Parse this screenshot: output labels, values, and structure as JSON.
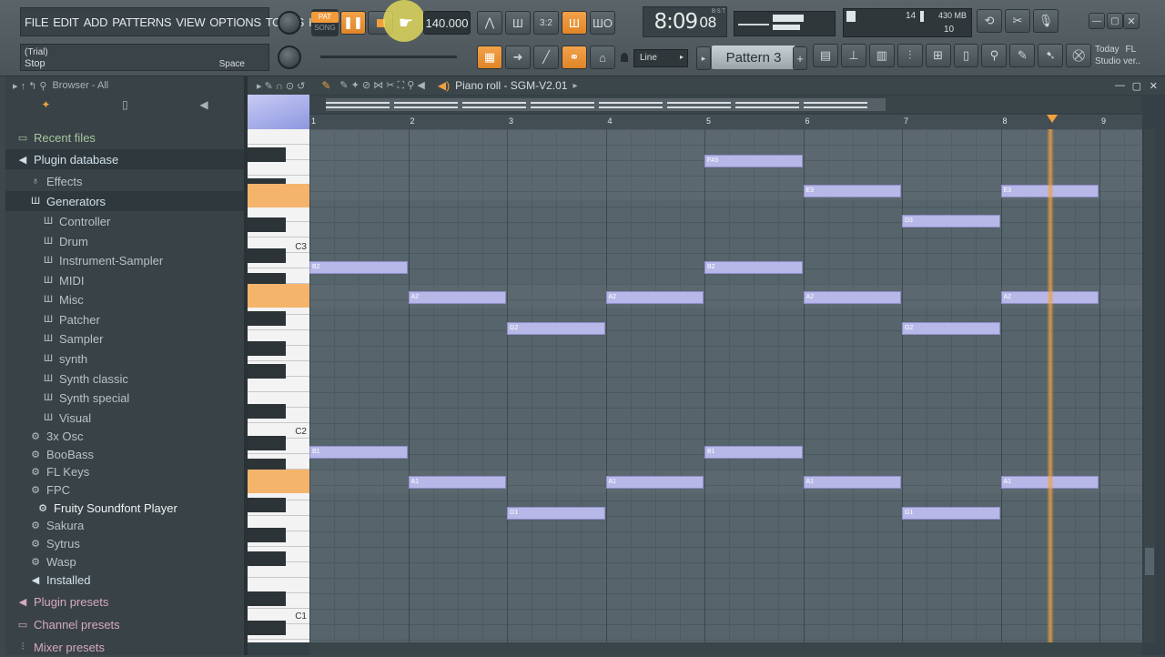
{
  "menu": [
    "FILE",
    "EDIT",
    "ADD",
    "PATTERNS",
    "VIEW",
    "OPTIONS",
    "TOOLS",
    "HELP"
  ],
  "hint": {
    "line1": "(Trial)",
    "line2": "Stop",
    "shortcut": "Space"
  },
  "transport": {
    "pat": "PAT",
    "song": "SONG",
    "tempo": "140.000",
    "time": "8:09",
    "time_small": "08",
    "bst": "B:S:T"
  },
  "cpu": {
    "mem": "430 MB",
    "val1": "14",
    "val2": "10"
  },
  "snap": "Line",
  "pattern": "Pattern 3",
  "news": {
    "l1": "Today",
    "l2": "FL",
    "l3": "Studio ver.."
  },
  "browser": {
    "title": "Browser - All",
    "items": [
      {
        "label": "Recent files",
        "icon": "folder-icon",
        "color": "#a6c5a0"
      },
      {
        "label": "Plugin database",
        "icon": "speaker-icon",
        "color": "#cfe0ea"
      },
      {
        "label": "Effects",
        "icon": "mic-icon",
        "color": "#b7c2c7"
      },
      {
        "label": "Generators",
        "icon": "piano-icon",
        "color": "#cfe0ea"
      },
      {
        "label": "Controller",
        "icon": "piano-icon",
        "color": "#b7c2c7"
      },
      {
        "label": "Drum",
        "icon": "piano-icon",
        "color": "#b7c2c7"
      },
      {
        "label": "Instrument-Sampler",
        "icon": "piano-icon",
        "color": "#b7c2c7"
      },
      {
        "label": "MIDI",
        "icon": "piano-icon",
        "color": "#b7c2c7"
      },
      {
        "label": "Misc",
        "icon": "piano-icon",
        "color": "#b7c2c7"
      },
      {
        "label": "Patcher",
        "icon": "piano-icon",
        "color": "#b7c2c7"
      },
      {
        "label": "Sampler",
        "icon": "piano-icon",
        "color": "#b7c2c7"
      },
      {
        "label": "synth",
        "icon": "piano-icon",
        "color": "#b7c2c7"
      },
      {
        "label": "Synth classic",
        "icon": "piano-icon",
        "color": "#b7c2c7"
      },
      {
        "label": "Synth special",
        "icon": "piano-icon",
        "color": "#b7c2c7"
      },
      {
        "label": "Visual",
        "icon": "piano-icon",
        "color": "#b7c2c7"
      },
      {
        "label": "3x Osc",
        "icon": "gear-icon",
        "color": "#b7c2c7"
      },
      {
        "label": "BooBass",
        "icon": "gear-icon",
        "color": "#b7c2c7"
      },
      {
        "label": "FL Keys",
        "icon": "gear-icon",
        "color": "#b7c2c7"
      },
      {
        "label": "FPC",
        "icon": "gear-icon",
        "color": "#b7c2c7"
      },
      {
        "label": "Fruity Soundfont Player",
        "icon": "gear-icon",
        "color": "#eef2f3"
      },
      {
        "label": "Sakura",
        "icon": "gear-icon",
        "color": "#b7c2c7"
      },
      {
        "label": "Sytrus",
        "icon": "gear-icon",
        "color": "#b7c2c7"
      },
      {
        "label": "Wasp",
        "icon": "gear-icon",
        "color": "#b7c2c7"
      },
      {
        "label": "Installed",
        "icon": "speaker-icon",
        "color": "#cfe0ea"
      },
      {
        "label": "Plugin presets",
        "icon": "speaker-icon",
        "color": "#d6a9c2"
      },
      {
        "label": "Channel presets",
        "icon": "channel-icon",
        "color": "#d6a9c2"
      },
      {
        "label": "Mixer presets",
        "icon": "mixer-icon",
        "color": "#d6a9c2"
      }
    ]
  },
  "pianoroll": {
    "title": "Piano roll - SGM-V2.01",
    "bars": [
      "1",
      "2",
      "3",
      "4",
      "5",
      "6",
      "7",
      "8",
      "9"
    ],
    "octaves": [
      "C3",
      "C2",
      "C1"
    ]
  },
  "notes": [
    {
      "label": "F#3",
      "bar": 5,
      "len": 1,
      "row": 0
    },
    {
      "label": "E3",
      "bar": 6,
      "len": 1,
      "row": 1
    },
    {
      "label": "E3",
      "bar": 8,
      "len": 1,
      "row": 1
    },
    {
      "label": "D3",
      "bar": 7,
      "len": 1,
      "row": 2
    },
    {
      "label": "B2",
      "bar": 1,
      "len": 1,
      "row": 3
    },
    {
      "label": "B2",
      "bar": 5,
      "len": 1,
      "row": 3
    },
    {
      "label": "A2",
      "bar": 2,
      "len": 1,
      "row": 4
    },
    {
      "label": "A2",
      "bar": 4,
      "len": 1,
      "row": 4
    },
    {
      "label": "A2",
      "bar": 6,
      "len": 1,
      "row": 4
    },
    {
      "label": "A2",
      "bar": 8,
      "len": 1,
      "row": 4
    },
    {
      "label": "G2",
      "bar": 3,
      "len": 1,
      "row": 5
    },
    {
      "label": "G2",
      "bar": 7,
      "len": 1,
      "row": 5
    },
    {
      "label": "B1",
      "bar": 1,
      "len": 1,
      "row": 6
    },
    {
      "label": "B1",
      "bar": 5,
      "len": 1,
      "row": 6
    },
    {
      "label": "A1",
      "bar": 2,
      "len": 1,
      "row": 7
    },
    {
      "label": "A1",
      "bar": 4,
      "len": 1,
      "row": 7
    },
    {
      "label": "A1",
      "bar": 6,
      "len": 1,
      "row": 7
    },
    {
      "label": "A1",
      "bar": 8,
      "len": 1,
      "row": 7
    },
    {
      "label": "G1",
      "bar": 3,
      "len": 1,
      "row": 8
    },
    {
      "label": "G1",
      "bar": 7,
      "len": 1,
      "row": 8
    }
  ],
  "playhead_bar": 8.5
}
